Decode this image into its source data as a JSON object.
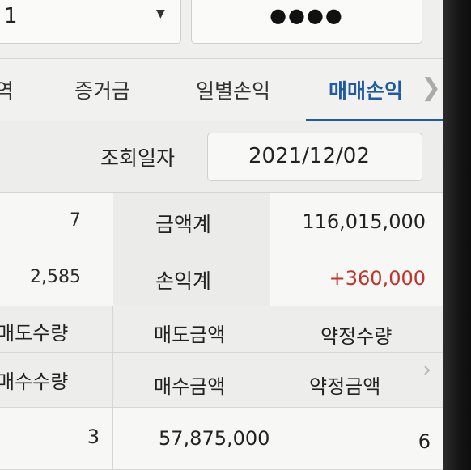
{
  "header": {
    "account_value": "1",
    "password_masked": "●●●●"
  },
  "tabs": [
    {
      "label": "역",
      "active": false
    },
    {
      "label": "증거금",
      "active": false
    },
    {
      "label": "일별손익",
      "active": false
    },
    {
      "label": "매매손익",
      "active": true
    }
  ],
  "query": {
    "date_label": "조회일자",
    "date_value": "2021/12/02"
  },
  "summary": {
    "rows": [
      {
        "left_value": "7",
        "label": "금액계",
        "right_value": "116,015,000"
      },
      {
        "left_value": "2,585",
        "label": "손익계",
        "right_value": "+360,000"
      }
    ]
  },
  "grid": {
    "header_row1": [
      "매도수량",
      "매도금액",
      "약정수량"
    ],
    "header_row2": [
      "매수수량",
      "매수금액",
      "약정금액"
    ],
    "data_row": [
      "3",
      "57,875,000",
      "6"
    ]
  },
  "colors": {
    "active_tab": "#1f5aa6",
    "profit": "#c0332b"
  }
}
